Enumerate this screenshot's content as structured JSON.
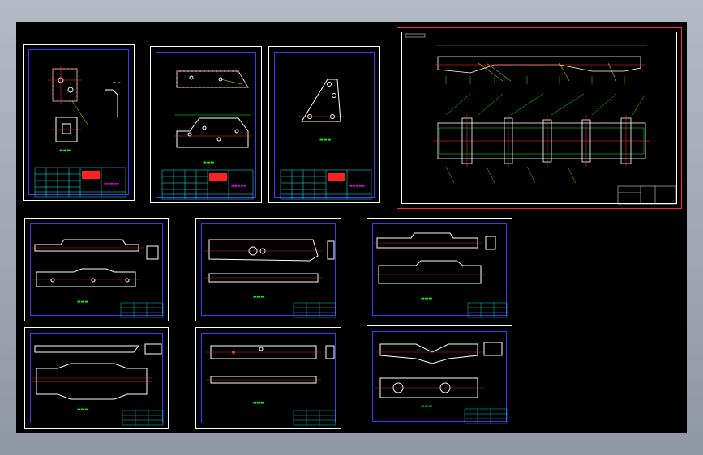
{
  "app": {
    "title": ""
  },
  "canvas": {
    "background": "#000000",
    "frame_color": "#ffffff",
    "main_frame_color": "#ff2a2a",
    "inner_border": "#3a3aff"
  },
  "colors": {
    "geometry": "#ffffff",
    "dimension": "#00ff00",
    "centerline": "#ff3030",
    "leader": "#ffff00",
    "table": "#00ffff",
    "title_block": "#ff00ff"
  },
  "sheets": [
    {
      "id": "bracket-detail-1"
    },
    {
      "id": "plate-detail-2"
    },
    {
      "id": "gusset-detail-3"
    },
    {
      "id": "frame-assembly"
    },
    {
      "id": "side-rail-a"
    },
    {
      "id": "side-rail-b"
    },
    {
      "id": "side-rail-c"
    },
    {
      "id": "long-member-a"
    },
    {
      "id": "long-member-b"
    },
    {
      "id": "long-member-c"
    }
  ]
}
